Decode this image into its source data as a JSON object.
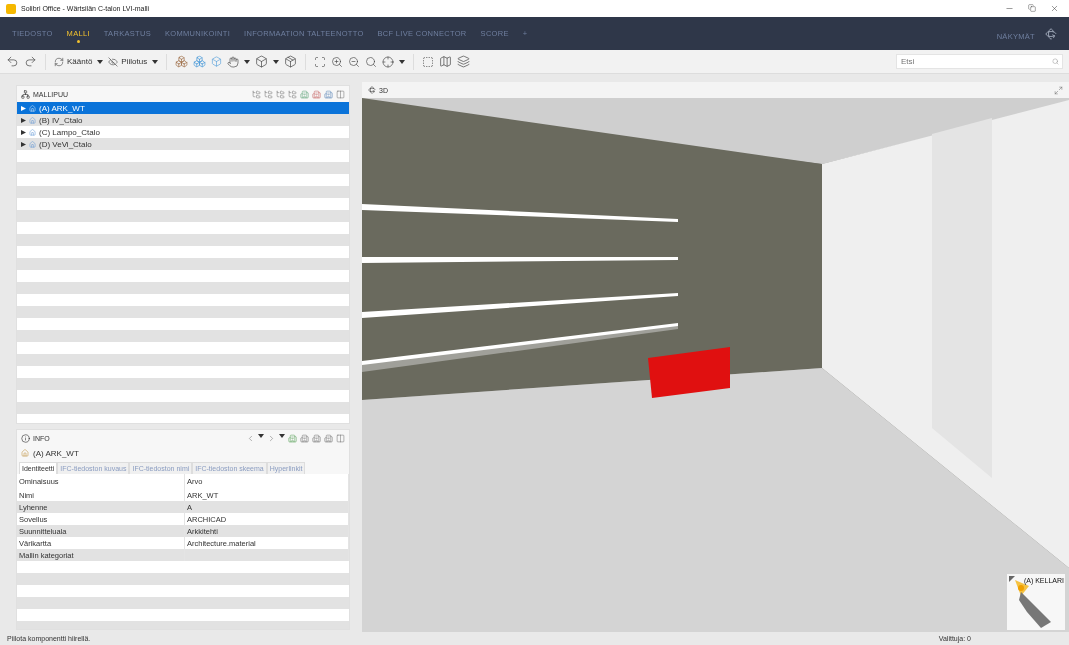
{
  "window": {
    "title": "Solibri Office - Wärtsilän C-talon LVI-malli"
  },
  "nav": {
    "tabs": [
      {
        "label": "TIEDOSTO",
        "selected": false
      },
      {
        "label": "MALLI",
        "selected": true
      },
      {
        "label": "TARKASTUS",
        "selected": false
      },
      {
        "label": "KOMMUNIKOINTI",
        "selected": false
      },
      {
        "label": "INFORMAATION TALTEENOTTO",
        "selected": false
      },
      {
        "label": "BCF LIVE CONNECTOR",
        "selected": false
      },
      {
        "label": "SCORE",
        "selected": false
      },
      {
        "label": "+",
        "selected": false
      }
    ],
    "right_label": "NÄKYMÄT"
  },
  "toolbar": {
    "rotate_label": "Kääntö",
    "hide_label": "Piilotus",
    "search": {
      "placeholder": "Etsi"
    }
  },
  "model_tree": {
    "title": "MALLIPUU",
    "items": [
      {
        "label": "(A) ARK_WT",
        "selected": true
      },
      {
        "label": "(B) IV_Ctalo",
        "selected": false
      },
      {
        "label": "(C) Lampo_Ctalo",
        "selected": false
      },
      {
        "label": "(D) VeVi_Ctalo",
        "selected": false
      }
    ]
  },
  "info": {
    "title": "INFO",
    "object": "(A) ARK_WT",
    "tabs": [
      {
        "label": "Identiteetti",
        "selected": true
      },
      {
        "label": "IFC-tiedoston kuvaus",
        "selected": false
      },
      {
        "label": "IFC-tiedoston nimi",
        "selected": false
      },
      {
        "label": "IFC-tiedoston skeema",
        "selected": false
      },
      {
        "label": "Hyperlinkit",
        "selected": false
      }
    ],
    "columns": [
      "Ominaisuus",
      "Arvo"
    ],
    "rows": [
      {
        "property": "Nimi",
        "value": "ARK_WT"
      },
      {
        "property": "Lyhenne",
        "value": "A"
      },
      {
        "property": "Sovellus",
        "value": "ARCHICAD"
      },
      {
        "property": "Suunnitteluala",
        "value": "Arkkitehti"
      },
      {
        "property": "Värikartta",
        "value": "Architecture.material"
      },
      {
        "property": "Mallin kategoriat"
      }
    ]
  },
  "view": {
    "title": "3D",
    "navigator_label": "(A) KELLARI"
  },
  "status_bar": {
    "hint": "Piilota komponentti hiirellä.",
    "selected_count": "Valittuja: 0"
  }
}
